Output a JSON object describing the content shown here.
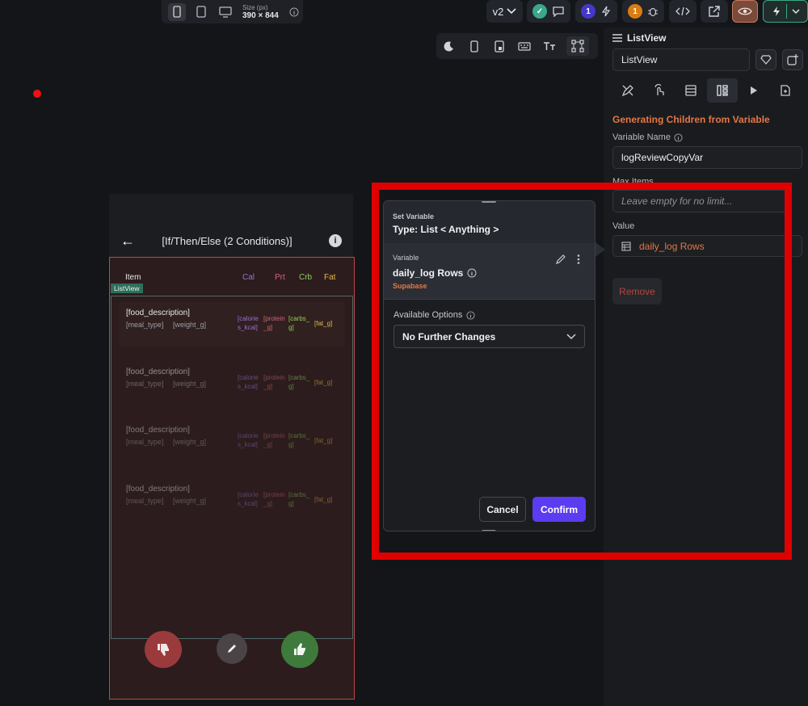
{
  "top_toolbar": {
    "size_label": "Size (px)",
    "size_value": "390 × 844",
    "version": "v2",
    "badge_blue": "1",
    "badge_orange": "1"
  },
  "phone": {
    "title": "[If/Then/Else (2 Conditions)]",
    "header": {
      "item": "Item",
      "cal": "Cal",
      "prt": "Prt",
      "crb": "Crb",
      "fat": "Fat"
    },
    "listview_tag": "ListView",
    "rows": [
      {
        "food": "[food_description]",
        "meal": "[meal_type]",
        "weight": "[weight_g]",
        "cal": "[calorie\ns_kcal]",
        "prt": "[protein\n_g]",
        "crb": "[carbs_\ng]",
        "fat": "[fat_g]"
      },
      {
        "food": "[food_description]",
        "meal": "[meal_type]",
        "weight": "[weight_g]",
        "cal": "[calorie\ns_kcal]",
        "prt": "[protein\n_g]",
        "crb": "[carbs_\ng]",
        "fat": "[fat_g]"
      },
      {
        "food": "[food_description]",
        "meal": "[meal_type]",
        "weight": "[weight_g]",
        "cal": "[calorie\ns_kcal]",
        "prt": "[protein\n_g]",
        "crb": "[carbs_\ng]",
        "fat": "[fat_g]"
      },
      {
        "food": "[food_description]",
        "meal": "[meal_type]",
        "weight": "[weight_g]",
        "cal": "[calorie\ns_kcal]",
        "prt": "[protein\n_g]",
        "crb": "[carbs_\ng]",
        "fat": "[fat_g]"
      }
    ]
  },
  "popup": {
    "set_variable_label": "Set Variable",
    "type_label": "Type: List < Anything >",
    "variable_label": "Variable",
    "variable_name": "daily_log Rows",
    "source": "Supabase",
    "available_options_label": "Available Options",
    "option_selected": "No Further Changes",
    "cancel": "Cancel",
    "confirm": "Confirm"
  },
  "right_panel": {
    "heading": "ListView",
    "name_field": "ListView",
    "section_title": "Generating Children from Variable",
    "variable_name_label": "Variable Name",
    "variable_name_value": "logReviewCopyVar",
    "max_items_label": "Max Items",
    "max_items_placeholder": "Leave empty for no limit...",
    "value_label": "Value",
    "value_text": "daily_log Rows",
    "remove": "Remove"
  },
  "colors": {
    "accent_purple": "#5b3cf0",
    "accent_orange": "#e07848",
    "highlight_red": "#e00000",
    "cal": "#9b6fd9",
    "prt": "#d9607a",
    "crb": "#8fcf5a",
    "fat": "#e3b84a"
  }
}
